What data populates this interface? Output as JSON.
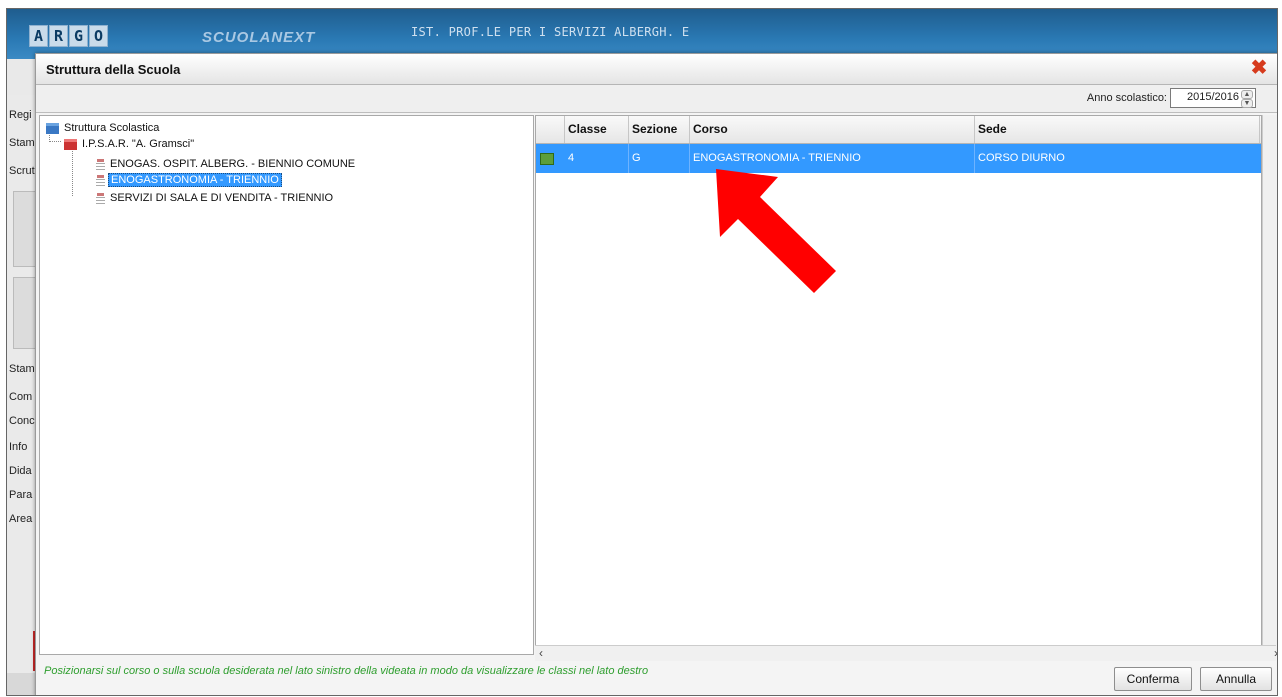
{
  "app": {
    "logo_letters": [
      "A",
      "R",
      "G",
      "O"
    ],
    "product_name": "SCUOLANEXT",
    "institution": "IST. PROF.LE PER I SERVIZI ALBERGH. E"
  },
  "side_menu": {
    "items": [
      "Regi",
      "Stam",
      "Scrut",
      "Stam",
      "Com",
      "Conc",
      "Info",
      "Dida",
      "Para",
      "Area"
    ]
  },
  "dialog": {
    "title": "Struttura della Scuola",
    "close_glyph": "✖",
    "anno_label": "Anno scolastico:",
    "anno_value": "2015/2016",
    "spinner_up": "▲",
    "spinner_down": "▼",
    "hint": "Posizionarsi sul corso o sulla scuola desiderata nel lato sinistro della videata in modo da visualizzare le classi nel lato destro",
    "confirm_label": "Conferma",
    "cancel_label": "Annulla",
    "scroll_left": "‹",
    "scroll_right": "›"
  },
  "tree": {
    "root": "Struttura Scolastica",
    "school": "I.P.S.A.R. \"A. Gramsci\"",
    "corsi": [
      "ENOGAS. OSPIT. ALBERG. - BIENNIO COMUNE",
      "ENOGASTRONOMIA - TRIENNIO",
      "SERVIZI DI SALA E DI VENDITA - TRIENNIO"
    ]
  },
  "grid": {
    "columns": [
      "Classe",
      "Sezione",
      "Corso",
      "Sede"
    ],
    "rows": [
      {
        "classe": "4",
        "sezione": "G",
        "corso": "ENOGASTRONOMIA - TRIENNIO",
        "sede": "CORSO DIURNO"
      }
    ]
  },
  "colors": {
    "selection": "#3399ff",
    "hint_text": "#2e9e2e",
    "annotation_arrow": "#ff0000",
    "close_icon": "#d63b1d"
  }
}
